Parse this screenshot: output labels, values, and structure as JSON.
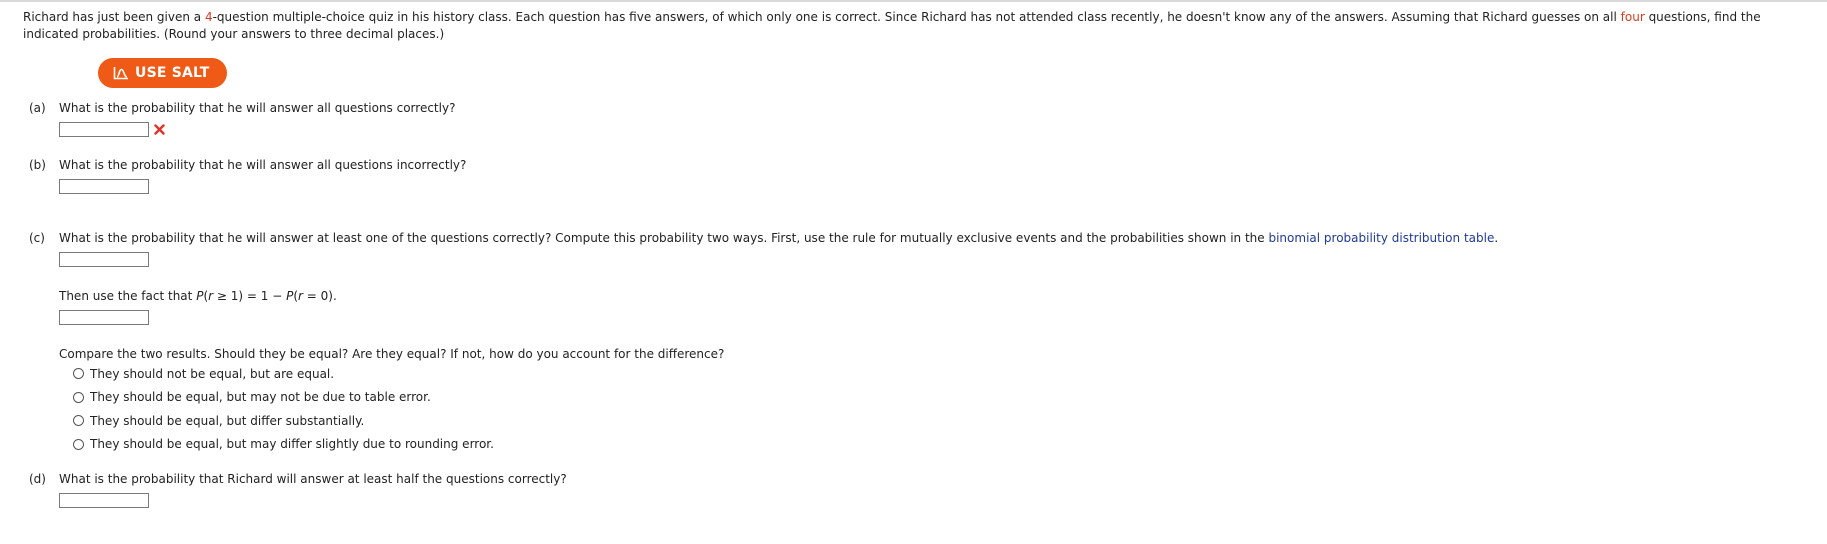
{
  "intro": {
    "pre": "Richard has just been given a ",
    "num_questions": "4",
    "mid": "-question multiple-choice quiz in his history class. Each question has five answers, of which only one is correct. Since Richard has not attended class recently, he doesn't know any of the answers. Assuming that Richard guesses on all ",
    "count_word": "four",
    "post": " questions, find the indicated probabilities. (Round your answers to three decimal places.)"
  },
  "salt_button": {
    "label": "USE SALT"
  },
  "parts": {
    "a": {
      "label": "(a)",
      "question": "What is the probability that he will answer all questions correctly?",
      "value": ""
    },
    "b": {
      "label": "(b)",
      "question": "What is the probability that he will answer all questions incorrectly?",
      "value": ""
    },
    "c": {
      "label": "(c)",
      "question": "What is the probability that he will answer at least one of the questions correctly? Compute this probability two ways. First, use the rule for mutually exclusive events and the probabilities shown in the ",
      "link_text": "binomial probability distribution table",
      "question_end": ".",
      "value1": "",
      "then_text": "Then use the fact that ",
      "formula_p1": "P",
      "formula_open1": "(",
      "formula_r1": "r",
      "formula_rest1": " ≥ 1) = 1 − ",
      "formula_p2": "P",
      "formula_open2": "(",
      "formula_r2": "r",
      "formula_rest2": " = 0).",
      "value2": "",
      "compare": "Compare the two results. Should they be equal? Are they equal? If not, how do you account for the difference?",
      "options": [
        "They should not be equal, but are equal.",
        "They should be equal, but may not be due to table error.",
        "They should be equal, but differ substantially.",
        "They should be equal, but may differ slightly due to rounding error."
      ]
    },
    "d": {
      "label": "(d)",
      "question": "What is the probability that Richard will answer at least half the questions correctly?",
      "value": ""
    }
  },
  "colors": {
    "accent_orange": "#ef5a16",
    "error_red": "#e0322a",
    "link_blue": "#1f3a99",
    "highlight_red": "#d93c1f"
  },
  "icons": {
    "salt": "chart-line-icon",
    "incorrect": "close-icon"
  }
}
